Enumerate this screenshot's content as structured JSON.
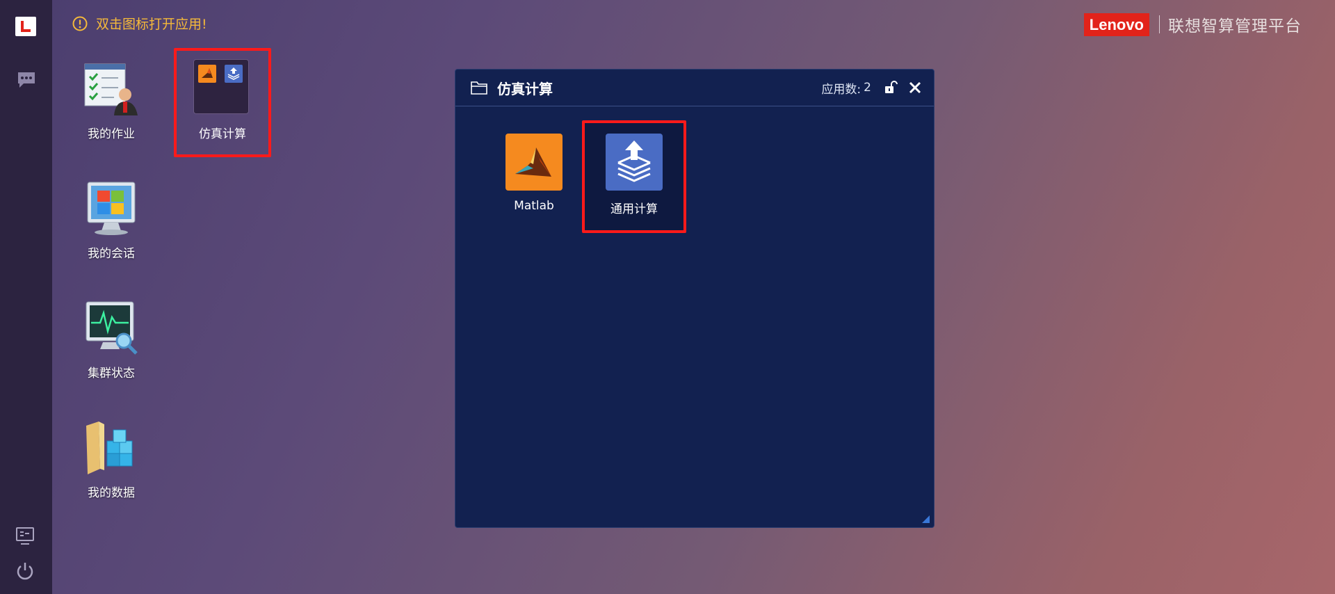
{
  "notice": {
    "text": "双击图标打开应用!",
    "icon": "exclamation-circle-icon",
    "color": "#f5b93a"
  },
  "brand": {
    "logo_text": "Lenovo",
    "platform_name": "联想智算管理平台",
    "logo_color": "#e2231a"
  },
  "sidebar": {
    "items": [
      {
        "name": "lenovo-logo-icon"
      },
      {
        "name": "chat-icon"
      },
      {
        "name": "monitor-icon"
      },
      {
        "name": "power-icon"
      }
    ]
  },
  "desktop": {
    "icons": [
      {
        "label": "我的作业",
        "icon": "my-jobs-icon"
      },
      {
        "label": "我的会话",
        "icon": "my-sessions-icon"
      },
      {
        "label": "集群状态",
        "icon": "cluster-status-icon"
      },
      {
        "label": "我的数据",
        "icon": "my-data-icon"
      }
    ],
    "group": {
      "label": "仿真计算",
      "selected": true
    }
  },
  "folder_panel": {
    "title": "仿真计算",
    "count_label": "应用数:",
    "count": "2",
    "apps": [
      {
        "label": "Matlab",
        "icon": "matlab-icon",
        "color": "#f58a1f"
      },
      {
        "label": "通用计算",
        "icon": "upload-stack-icon",
        "color": "#4a6cc4",
        "selected": true
      }
    ],
    "background": "#122150"
  }
}
